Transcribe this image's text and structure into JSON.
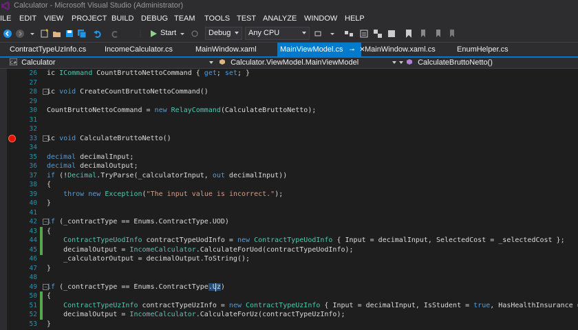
{
  "window": {
    "title": "Calculator - Microsoft Visual Studio (Administrator)"
  },
  "menu": [
    "ILE",
    "EDIT",
    "VIEW",
    "PROJECT",
    "BUILD",
    "DEBUG",
    "TEAM",
    "TOOLS",
    "TEST",
    "ANALYZE",
    "WINDOW",
    "HELP"
  ],
  "toolbar": {
    "start_label": "Start",
    "config_value": "Debug",
    "platform_value": "Any CPU"
  },
  "tabs": [
    {
      "label": "ContractTypeUzInfo.cs",
      "active": false
    },
    {
      "label": "IncomeCalculator.cs",
      "active": false
    },
    {
      "label": "MainWindow.xaml",
      "active": false
    },
    {
      "label": "MainViewModel.cs",
      "active": true
    },
    {
      "label": "MainWindow.xaml.cs",
      "active": false
    },
    {
      "label": "EnumHelper.cs",
      "active": false
    }
  ],
  "nav": {
    "project": "Calculator",
    "type": "Calculator.ViewModel.MainViewModel",
    "member": "CalculateBruttoNetto()"
  },
  "code_lines": [
    {
      "num": "26",
      "text": "ic ICommand CountBruttoNettoCommand { get; set; }"
    },
    {
      "num": "27",
      "text": ""
    },
    {
      "num": "28",
      "text": "ic void CreateCountBruttoNettoCommand()"
    },
    {
      "num": "29",
      "text": ""
    },
    {
      "num": "30",
      "text": "CountBruttoNettoCommand = new RelayCommand(CalculateBruttoNetto);"
    },
    {
      "num": "31",
      "text": ""
    },
    {
      "num": "32",
      "text": ""
    },
    {
      "num": "33",
      "text": "ic void CalculateBruttoNetto()"
    },
    {
      "num": "34",
      "text": ""
    },
    {
      "num": "35",
      "text": "decimal decimalInput;"
    },
    {
      "num": "36",
      "text": "decimal decimalOutput;"
    },
    {
      "num": "37",
      "text": "if (!Decimal.TryParse(_calculatorInput, out decimalInput))"
    },
    {
      "num": "38",
      "text": "{"
    },
    {
      "num": "39",
      "text": "    throw new Exception(\"The input value is incorrect.\");"
    },
    {
      "num": "40",
      "text": "}"
    },
    {
      "num": "41",
      "text": ""
    },
    {
      "num": "42",
      "text": "if (_contractType == Enums.ContractType.UOD)"
    },
    {
      "num": "43",
      "text": "{"
    },
    {
      "num": "44",
      "text": "    ContractTypeUodInfo contractTypeUodInfo = new ContractTypeUodInfo { Input = decimalInput, SelectedCost = _selectedCost };"
    },
    {
      "num": "45",
      "text": "    decimalOutput = IncomeCalculator.CalculateForUod(contractTypeUodInfo);"
    },
    {
      "num": "46",
      "text": "    _calculatorOutput = decimalOutput.ToString();"
    },
    {
      "num": "47",
      "text": "}"
    },
    {
      "num": "48",
      "text": ""
    },
    {
      "num": "49",
      "text": "if (_contractType == Enums.ContractType.Uz)"
    },
    {
      "num": "50",
      "text": "{"
    },
    {
      "num": "51",
      "text": "    ContractTypeUzInfo contractTypeUzInfo = new ContractTypeUzInfo { Input = decimalInput, IsStudent = true, HasHealthInsurance = t"
    },
    {
      "num": "52",
      "text": "    decimalOutput = IncomeCalculator.CalculateForUz(contractTypeUzInfo);"
    },
    {
      "num": "53",
      "text": "}"
    }
  ],
  "colors": {
    "accent": "#007acc",
    "breakpoint": "#e51400",
    "change_bar": "#57a64a"
  }
}
